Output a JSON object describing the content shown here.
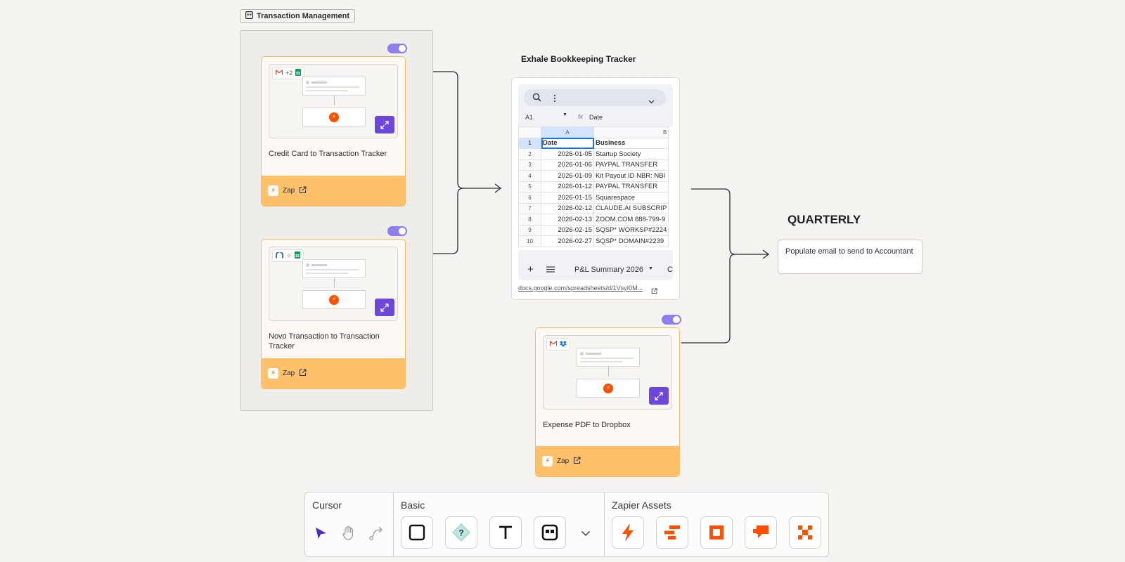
{
  "group": {
    "label": "Transaction Management"
  },
  "zaps": [
    {
      "title": "Credit Card to Transaction Tracker",
      "apps_extra": "+2",
      "footer_label": "Zap",
      "enabled": true
    },
    {
      "title": "Novo Transaction to Transaction Tracker",
      "footer_label": "Zap",
      "enabled": true
    },
    {
      "title": "Expense PDF to Dropbox",
      "footer_label": "Zap",
      "enabled": true
    }
  ],
  "sheet": {
    "title": "Exhale Bookkeeping Tracker",
    "cell_ref": "A1",
    "formula_value": "Date",
    "col_a": "A",
    "col_b": "B",
    "rows": [
      {
        "n": "1",
        "date": "Date",
        "business": "Business"
      },
      {
        "n": "2",
        "date": "2026-01-05",
        "business": "Startup Society"
      },
      {
        "n": "3",
        "date": "2026-01-06",
        "business": "PAYPAL TRANSFER"
      },
      {
        "n": "4",
        "date": "2026-01-09",
        "business": "Kit Payout ID NBR: NBI"
      },
      {
        "n": "5",
        "date": "2026-01-12",
        "business": "PAYPAL TRANSFER"
      },
      {
        "n": "6",
        "date": "2026-01-15",
        "business": "Squarespace"
      },
      {
        "n": "7",
        "date": "2026-02-12",
        "business": "CLAUDE.AI SUBSCRIP"
      },
      {
        "n": "8",
        "date": "2026-02-13",
        "business": "ZOOM.COM 888-799-9"
      },
      {
        "n": "9",
        "date": "2026-02-15",
        "business": "SQSP* WORKSP#2224"
      },
      {
        "n": "10",
        "date": "2026-02-27",
        "business": "SQSP* DOMAIN#2239"
      }
    ],
    "tab_name": "P&L Summary 2026",
    "tab_next": "C",
    "link": "docs.google.com/spreadsheets/d/1VsyI0M..."
  },
  "quarterly": {
    "title": "QUARTERLY",
    "note": "Populate email to send to Accountant"
  },
  "toolbar": {
    "cursor_label": "Cursor",
    "basic_label": "Basic",
    "assets_label": "Zapier Assets"
  },
  "colors": {
    "accent": "#6b47dc",
    "zapier_orange": "#ff4f00",
    "card_footer": "#ffc06a",
    "card_border": "#f8bd6a",
    "toggle": "#8f7ef0"
  }
}
